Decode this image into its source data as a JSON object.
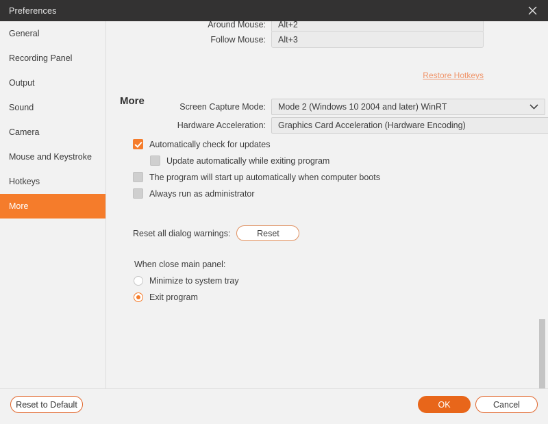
{
  "titlebar": {
    "title": "Preferences",
    "close_icon": "close-icon"
  },
  "sidebar": {
    "items": [
      {
        "label": "General",
        "active": false
      },
      {
        "label": "Recording Panel",
        "active": false
      },
      {
        "label": "Output",
        "active": false
      },
      {
        "label": "Sound",
        "active": false
      },
      {
        "label": "Camera",
        "active": false
      },
      {
        "label": "Mouse and Keystroke",
        "active": false
      },
      {
        "label": "Hotkeys",
        "active": false
      },
      {
        "label": "More",
        "active": true
      }
    ]
  },
  "hotkeys": {
    "around_mouse": {
      "label": "Around Mouse:",
      "value": "Alt+2"
    },
    "follow_mouse": {
      "label": "Follow Mouse:",
      "value": "Alt+3"
    },
    "restore_link": "Restore Hotkeys"
  },
  "more": {
    "section_title": "More",
    "screen_capture_mode": {
      "label": "Screen Capture Mode:",
      "value": "Mode 2 (Windows 10 2004 and later) WinRT",
      "help_icon": "help-icon"
    },
    "hardware_acceleration": {
      "label": "Hardware Acceleration:",
      "value": "Graphics Card Acceleration (Hardware Encoding)"
    },
    "checkboxes": [
      {
        "label": "Automatically check for updates",
        "checked": true
      },
      {
        "label": "Update automatically while exiting program",
        "checked": false
      },
      {
        "label": "The program will start up automatically when computer boots",
        "checked": false
      },
      {
        "label": "Always run as administrator",
        "checked": false
      }
    ],
    "reset_warnings": {
      "label": "Reset all dialog warnings:",
      "button": "Reset"
    },
    "close_panel": {
      "label": "When close main panel:",
      "options": [
        {
          "label": "Minimize to system tray",
          "selected": false
        },
        {
          "label": "Exit program",
          "selected": true
        }
      ]
    }
  },
  "footer": {
    "reset_to_default": "Reset to Default",
    "ok": "OK",
    "cancel": "Cancel"
  },
  "colors": {
    "accent": "#f57c2b",
    "ok_button": "#e8661a",
    "titlebar": "#333232",
    "panel": "#f2f2f2",
    "link": "#f0956a"
  }
}
